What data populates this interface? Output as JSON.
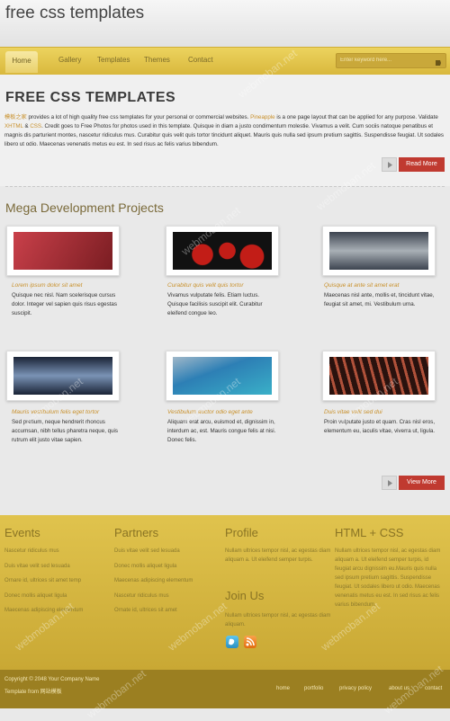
{
  "site": {
    "title": "free css templates"
  },
  "nav": {
    "items": [
      "Home",
      "Gallery",
      "Templates",
      "Themes",
      "Contact"
    ],
    "search_placeholder": "Enter keyword here..."
  },
  "hero": {
    "title": "FREE CSS TEMPLATES",
    "text_parts": [
      {
        "t": "模板之家",
        "hl": true
      },
      {
        "t": " provides a lot of high quality free css templates for your personal or commercial websites. ",
        "hl": false
      },
      {
        "t": "Pineapple",
        "hl": true
      },
      {
        "t": " is a one page layout that can be applied for any purpose. Validate ",
        "hl": false
      },
      {
        "t": "XHTML",
        "hl": true
      },
      {
        "t": " & ",
        "hl": false
      },
      {
        "t": "CSS",
        "hl": true
      },
      {
        "t": ". Credit goes to Free Photos for photos used in this template. Quisque in diam a justo condimentum molestie. Vivamus a velit. Cum sociis natoque penatibus et magnis dis parturient montes, nascetur ridiculus mus. Curabitur quis velit quis tortor tincidunt aliquet. Mauris quis nulla sed ipsum pretium sagittis. Suspendisse feugiat. Ut sodales libero ut odio. Maecenas venenatis metus eu est. In sed risus ac felis varius bibendum.",
        "hl": false
      }
    ],
    "more_label": "Read More"
  },
  "projects": {
    "title": "Mega Development Projects",
    "more_label": "View More",
    "items": [
      {
        "title": "Lorem ipsum dolor sit amet",
        "text": "Quisque nec nisl. Nam scelerisque cursus dolor. Integer vel sapien quis risus egestas suscipit.",
        "color1": "#c9404a",
        "color2": "#7a1d22"
      },
      {
        "title": "Curabitur quis velit quis tortor",
        "text": "Vivamus vulputate felis. Etiam luctus. Quisque facilisis suscipit elit. Curabitur eleifend congue leo.",
        "color1": "#111111",
        "color2": "#c21d17"
      },
      {
        "title": "Quisque at ante sit amet erat",
        "text": "Maecenas nisl ante, mollis et, tincidunt vitae, feugiat sit amet, mi. Vestibulum urna.",
        "color1": "#3d4450",
        "color2": "#a9b0b6"
      },
      {
        "title": "Mauris vestibulum felis eget tortor",
        "text": "Sed pretium, neque hendrerit rhoncus accumsan, nibh tellus pharetra neque, quis rutrum elit justo vitae sapien.",
        "color1": "#1a2336",
        "color2": "#7a93b5"
      },
      {
        "title": "Vestibulum auctor odio eget ante",
        "text": "Aliquam erat arcu, euismod et, dignissim in, interdum ac, est. Mauris congue felis at nisi. Donec felis.",
        "color1": "#2d7fb5",
        "color2": "#3ab0c8"
      },
      {
        "title": "Duis vitae velit sed dui",
        "text": "Proin vulputate justo et quam. Cras nisl eros, elementum eu, iaculis vitae, viverra ut, ligula.",
        "color1": "#2a120e",
        "color2": "#b0513a"
      }
    ]
  },
  "footer": {
    "events": {
      "title": "Events",
      "links": [
        "Nascetur ridiculus mus",
        "Duis vitae velit sed lesuada",
        "Ornare id, ultrices sit amet temp",
        "Donec mollis aliquet ligula",
        "Maecenas adipiscing elementum"
      ]
    },
    "partners": {
      "title": "Partners",
      "links": [
        "Duis vitae velit sed lesuada",
        "Donec mollis aliquet ligula",
        "Maecenas adipiscing elementum",
        "Nascetur ridiculus mus",
        "Ornate id, ultrices sit amet"
      ]
    },
    "profile": {
      "title": "Profile",
      "text": "Nullam ultrices tempor nisl, ac egestas diam aliquam a. Ut eleifend semper turpis."
    },
    "joinus": {
      "title": "Join Us",
      "text": "Nullam ultrices tempor nisl, ac egestas diam aliquam."
    },
    "htmlcss": {
      "title": "HTML + CSS",
      "text": "Nullam ultrices tempor nisl, ac egestas diam aliquam a. Ut eleifend semper turpis, id feugiat arcu dignissim eu.Mauris quis nulla sed ipsum pretium sagittis. Suspendisse feugiat. Ut sodales libero ut odio. Maecenas venenatis metus eu est. In sed risus ac felis varius bibendum."
    }
  },
  "bottom": {
    "copyright": "Copyright © 2048 Your Company Name",
    "template_from": "Template from 网站模板",
    "links": [
      "home",
      "portfolio",
      "privacy policy",
      "about us",
      "contact"
    ]
  },
  "watermark": "webmoban.net",
  "colors": {
    "accent": "#c03a30",
    "gold": "#d9b83d",
    "link": "#c8902b"
  }
}
